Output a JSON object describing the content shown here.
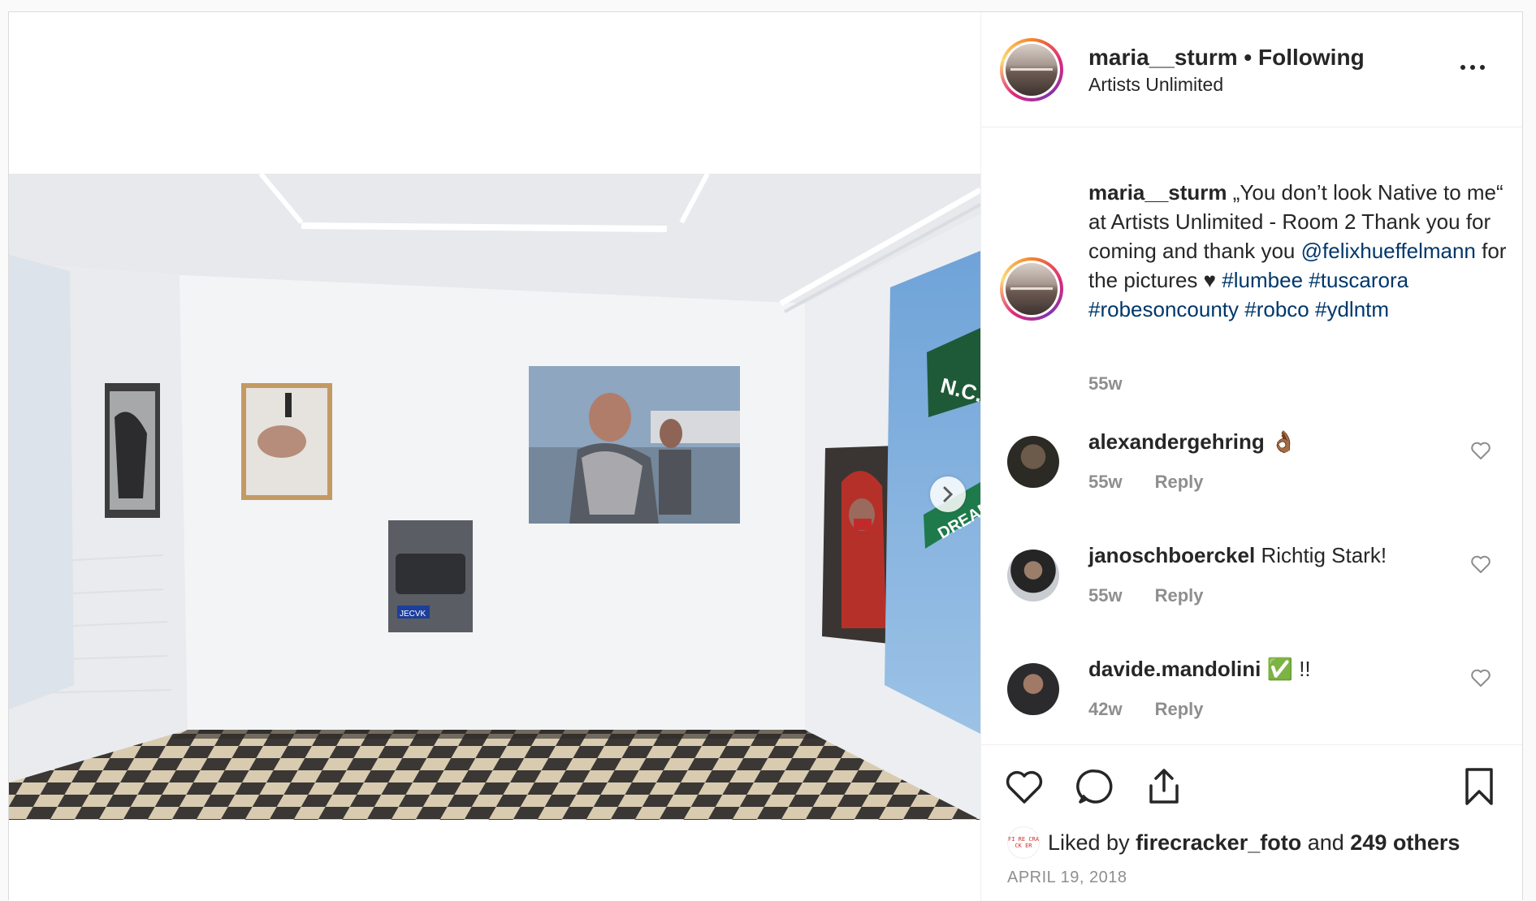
{
  "header": {
    "username": "maria__sturm",
    "separator": " • ",
    "follow_status": "Following",
    "location": "Artists Unlimited"
  },
  "caption": {
    "username": "maria__sturm",
    "text_1": " „You don’t look Native to me“ at Artists Unlimited - Room 2 Thank you for coming and thank you ",
    "mention": "@felixhueffelmann",
    "text_2": " for the pictures ♥ ",
    "hashtags": [
      "#lumbee",
      "#tuscarora",
      "#robesoncounty",
      "#robco",
      "#ydlntm"
    ],
    "time": "55w"
  },
  "comments": [
    {
      "username": "alexandergehring",
      "text": "👌🏾",
      "time": "55w",
      "reply": "Reply"
    },
    {
      "username": "janoschboerckel",
      "text": "Richtig Stark!",
      "time": "55w",
      "reply": "Reply"
    },
    {
      "username": "davide.mandolini",
      "text": "✅ !!",
      "time": "42w",
      "reply": "Reply"
    }
  ],
  "likes": {
    "prefix": "Liked by ",
    "liker": "firecracker_foto",
    "middle": " and ",
    "others": "249 others",
    "avatar_text": "FI RE CRA CK ER"
  },
  "date": "APRIL 19, 2018",
  "photo": {
    "street_sign_1": "N.C.",
    "street_sign_2": "DREAM",
    "plate": "JECVK"
  },
  "icons": {
    "more": "more-options-icon",
    "like": "heart-icon",
    "comment": "comment-icon",
    "share": "share-icon",
    "save": "bookmark-icon",
    "next": "chevron-right-icon"
  },
  "colors": {
    "link": "#00376b",
    "muted": "#8e8e8e",
    "text": "#262626"
  }
}
